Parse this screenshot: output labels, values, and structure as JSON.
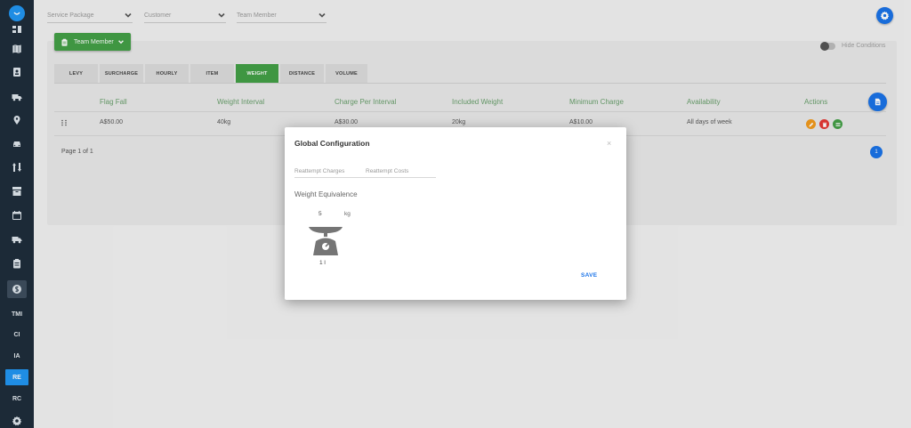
{
  "sidebar": {
    "icons": [
      "logo-icon",
      "dashboard-icon",
      "map-icon",
      "contact-icon",
      "truck-icon",
      "location-pin-icon",
      "car-icon",
      "transfer-icon",
      "archive-icon",
      "calendar-icon",
      "delivery-truck-icon",
      "clipboard-icon",
      "dollar-icon"
    ],
    "items": [
      {
        "label": "TMI",
        "active": false
      },
      {
        "label": "CI",
        "active": false
      },
      {
        "label": "IA",
        "active": false
      },
      {
        "label": "RE",
        "active": true
      },
      {
        "label": "RC",
        "active": false
      }
    ],
    "bottom_icon": "gear-icon"
  },
  "filters": {
    "service_package": "Service Package",
    "customer": "Customer",
    "team_member": "Team Member"
  },
  "team_member_button": "Team Member",
  "hide_conditions": "Hide Conditions",
  "tabs": [
    {
      "label": "LEVY",
      "active": false
    },
    {
      "label": "SURCHARGE",
      "active": false
    },
    {
      "label": "HOURLY",
      "active": false
    },
    {
      "label": "ITEM",
      "active": false
    },
    {
      "label": "WEIGHT",
      "active": true
    },
    {
      "label": "DISTANCE",
      "active": false
    },
    {
      "label": "VOLUME",
      "active": false
    }
  ],
  "table": {
    "headers": [
      "Flag Fall",
      "Weight Interval",
      "Charge Per Interval",
      "Included Weight",
      "Minimum Charge",
      "Availability",
      "Actions"
    ],
    "rows": [
      {
        "flag_fall": "A$50.00",
        "weight_interval": "40kg",
        "charge_per_interval": "A$30.00",
        "included_weight": "20kg",
        "minimum_charge": "A$10.00",
        "availability": "All days of week"
      }
    ],
    "actions": [
      "edit-icon",
      "delete-icon",
      "conditions-icon"
    ]
  },
  "pager": {
    "text": "Page 1 of 1",
    "current": "1"
  },
  "modal": {
    "title": "Global Configuration",
    "close": "×",
    "tabs": [
      "Reattempt Charges",
      "Reattempt Costs"
    ],
    "section": "Weight Equivalence",
    "value": "5",
    "unit": "kg",
    "count": "1 l",
    "save": "SAVE"
  },
  "colors": {
    "sidebar": "#1e2d3b",
    "accent_blue": "#1a73e8",
    "accent_green": "#43a047",
    "header_green": "#6aa06d"
  }
}
